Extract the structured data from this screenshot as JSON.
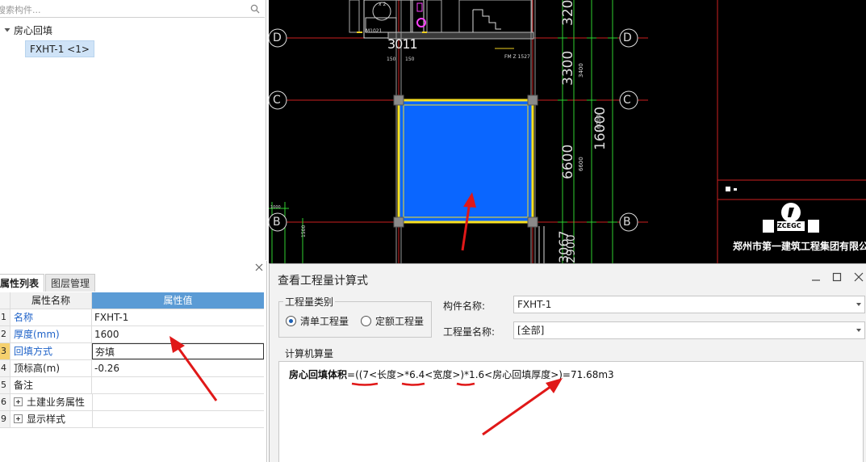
{
  "tree": {
    "search_placeholder": "搜索构件...",
    "root_label": "房心回填",
    "child_label": "FXHT-1 <1>"
  },
  "props": {
    "tabs": [
      "属性列表",
      "图层管理"
    ],
    "header": {
      "name": "属性名称",
      "value": "属性值"
    },
    "rows": [
      {
        "num": "1",
        "name": "名称",
        "value": "FXHT-1"
      },
      {
        "num": "2",
        "name": "厚度(mm)",
        "value": "1600"
      },
      {
        "num": "3",
        "name": "回填方式",
        "value": "夯填"
      },
      {
        "num": "4",
        "name": "顶标高(m)",
        "value": "-0.26"
      },
      {
        "num": "5",
        "name": "备注",
        "value": ""
      },
      {
        "num": "6",
        "name": "土建业务属性",
        "value": ""
      },
      {
        "num": "9",
        "name": "显示样式",
        "value": ""
      }
    ]
  },
  "cad": {
    "axis_labels": {
      "d": "D",
      "c": "C",
      "b": "B"
    },
    "dims": {
      "d3200": "3200",
      "d3300": "3300",
      "d6600": "6600",
      "d16000": "16000",
      "d3067": "3067",
      "d2900": "2900",
      "d3400": "3400",
      "d6600s": "6600",
      "d16000s": "16000"
    },
    "small": {
      "m1021": "M1021",
      "fm": "FM Z 1527",
      "s150a": "150",
      "s150b": "150",
      "s1500": "1500",
      "s1000": "1000",
      "x2": "x 2",
      "s3011": "3011"
    },
    "company": {
      "logo_text": "ZCEGC",
      "name": "郑州市第一建筑工程集团有限公司"
    }
  },
  "dialog": {
    "title": "查看工程量计算式",
    "group_type_label": "工程量类别",
    "radio_list": "清单工程量",
    "radio_quota": "定额工程量",
    "component_label": "构件名称:",
    "component_value": "FXHT-1",
    "quantity_label": "工程量名称:",
    "quantity_value": "[全部]",
    "calc_label": "计算机算量",
    "formula": {
      "name": "房心回填体积",
      "expr": "=((7<长度>*6.4<宽度>)*1.6<房心回填厚度>)=71.68m3"
    }
  }
}
